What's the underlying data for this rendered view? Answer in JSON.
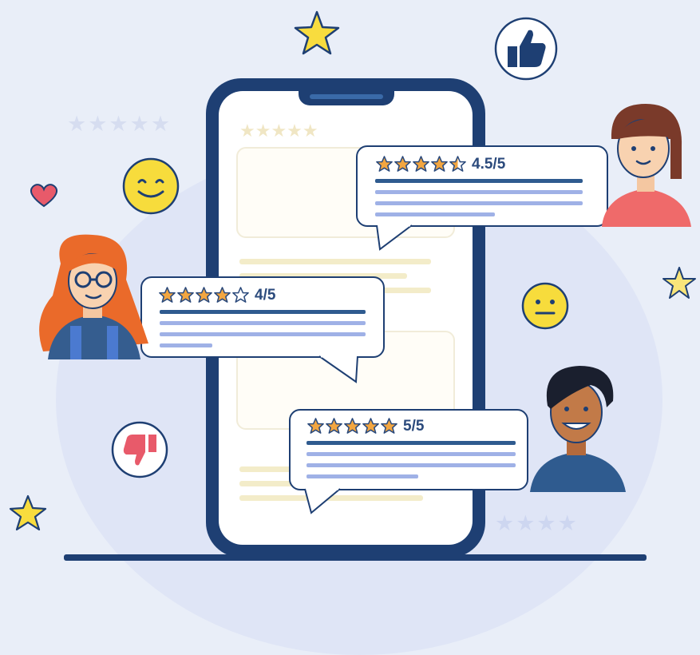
{
  "reviews": [
    {
      "rating": "4.5/5",
      "stars_filled": 4.5
    },
    {
      "rating": "4/5",
      "stars_filled": 4
    },
    {
      "rating": "5/5",
      "stars_filled": 5
    }
  ],
  "icons": [
    "thumbs-up-icon",
    "thumbs-down-icon",
    "heart-icon",
    "smiley-face-icon",
    "neutral-face-icon",
    "star-icon"
  ],
  "colors": {
    "navy": "#1e3f73",
    "star_fill": "#f3a640",
    "star_outline": "#2b4a7c",
    "background": "#e9eef8"
  }
}
